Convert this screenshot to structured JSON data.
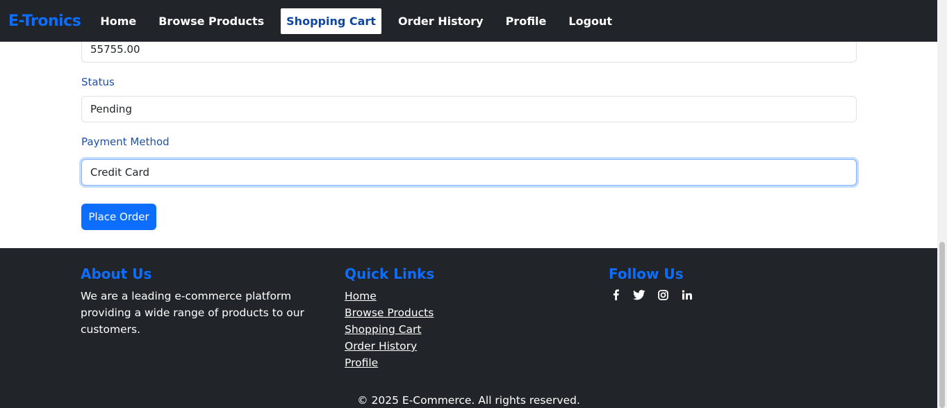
{
  "nav": {
    "brand": "E-Tronics",
    "items": [
      {
        "label": "Home"
      },
      {
        "label": "Browse Products"
      },
      {
        "label": "Shopping Cart"
      },
      {
        "label": "Order History"
      },
      {
        "label": "Profile"
      },
      {
        "label": "Logout"
      }
    ],
    "active": "Shopping Cart"
  },
  "form": {
    "total_value": "55755.00",
    "status_label": "Status",
    "status_value": "Pending",
    "payment_label": "Payment Method",
    "payment_value": "Credit Card",
    "submit_label": "Place Order"
  },
  "footer": {
    "about_title": "About Us",
    "about_text": "We are a leading e-commerce platform providing a wide range of products to our customers.",
    "links_title": "Quick Links",
    "links": [
      "Home",
      "Browse Products",
      "Shopping Cart",
      "Order History",
      "Profile"
    ],
    "follow_title": "Follow Us",
    "social": [
      "facebook-icon",
      "twitter-icon",
      "instagram-icon",
      "linkedin-icon"
    ],
    "copyright": "© 2025 E-Commerce. All rights reserved."
  },
  "colors": {
    "accent": "#0d6efd",
    "dark": "#212529"
  }
}
